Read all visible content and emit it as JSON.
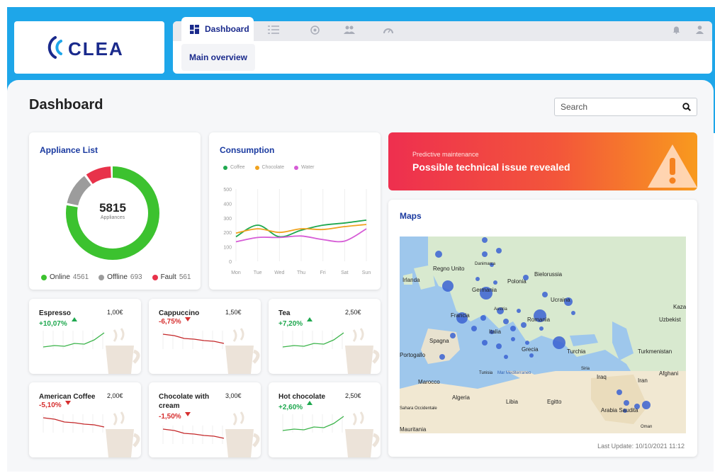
{
  "brand": {
    "logo_text": "CLEA"
  },
  "nav": {
    "active_tab": "Dashboard",
    "icons": [
      "list-icon",
      "coffee-icon",
      "users-icon",
      "gauge-icon"
    ],
    "sub_tab": "Main overview",
    "right_icons": [
      "bell-icon",
      "user-icon"
    ]
  },
  "page": {
    "title": "Dashboard"
  },
  "search": {
    "placeholder": "Search"
  },
  "appliance_list": {
    "title": "Appliance List",
    "total": "5815",
    "total_label": "Appliances",
    "legend": [
      {
        "label": "Online",
        "value": "4561",
        "color": "#3cc22f"
      },
      {
        "label": "Offline",
        "value": "693",
        "color": "#9c9c9c"
      },
      {
        "label": "Fault",
        "value": "561",
        "color": "#e8324a"
      }
    ]
  },
  "consumption": {
    "title": "Consumption",
    "chart_data": {
      "type": "line",
      "categories": [
        "Mon",
        "Tue",
        "Wed",
        "Thu",
        "Fri",
        "Sat",
        "Sun"
      ],
      "yticks": [
        "500",
        "400",
        "300",
        "200",
        "100",
        "0"
      ],
      "ylim": [
        0,
        500
      ],
      "series": [
        {
          "name": "Coffee",
          "color": "#1fa84f",
          "values": [
            170,
            250,
            170,
            215,
            250,
            265,
            285
          ]
        },
        {
          "name": "Chocolate",
          "color": "#f0a21e",
          "values": [
            195,
            225,
            200,
            225,
            220,
            240,
            255
          ]
        },
        {
          "name": "Water",
          "color": "#d65cd6",
          "values": [
            135,
            165,
            165,
            175,
            150,
            140,
            225
          ]
        }
      ]
    }
  },
  "products": [
    {
      "name": "Espresso",
      "price": "1,00€",
      "change": "+10,07%",
      "dir": "up"
    },
    {
      "name": "Cappuccino",
      "price": "1,50€",
      "change": "-6,75%",
      "dir": "down"
    },
    {
      "name": "Tea",
      "price": "2,50€",
      "change": "+7,20%",
      "dir": "up"
    },
    {
      "name": "American Coffee",
      "price": "2,00€",
      "change": "-5,10%",
      "dir": "down"
    },
    {
      "name": "Chocolate with cream",
      "price": "3,00€",
      "change": "-1,50%",
      "dir": "down"
    },
    {
      "name": "Hot chocolate",
      "price": "2,50€",
      "change": "+2,60%",
      "dir": "up"
    }
  ],
  "alert": {
    "subtitle": "Predictive maintenance",
    "title": "Possible technical issue revealed"
  },
  "maps": {
    "title": "Maps",
    "last_update": "Last Update: 10/10/2021 11:12",
    "labels": [
      "Regno Unito",
      "Irlanda",
      "Danimarca",
      "Bielorussia",
      "Germania",
      "Polonia",
      "Ucraina",
      "Kaza",
      "Francia",
      "Austria",
      "Romania",
      "Italia",
      "Uzbekist",
      "Spagna",
      "Grecia",
      "Turchia",
      "Turkmenistan",
      "Portogallo",
      "Tunisia",
      "Mar Mediterraneo",
      "Siria",
      "Afghani",
      "Iraq",
      "Iran",
      "Marocco",
      "Algeria",
      "Libia",
      "Egitto",
      "Arabia Saudita",
      "Sahara Occidentale",
      "Oman",
      "Mauritania"
    ]
  },
  "colors": {
    "accent": "#1ea6e9",
    "primary": "#1a3aa0",
    "positive": "#1fa84f",
    "negative": "#d62f2f"
  }
}
